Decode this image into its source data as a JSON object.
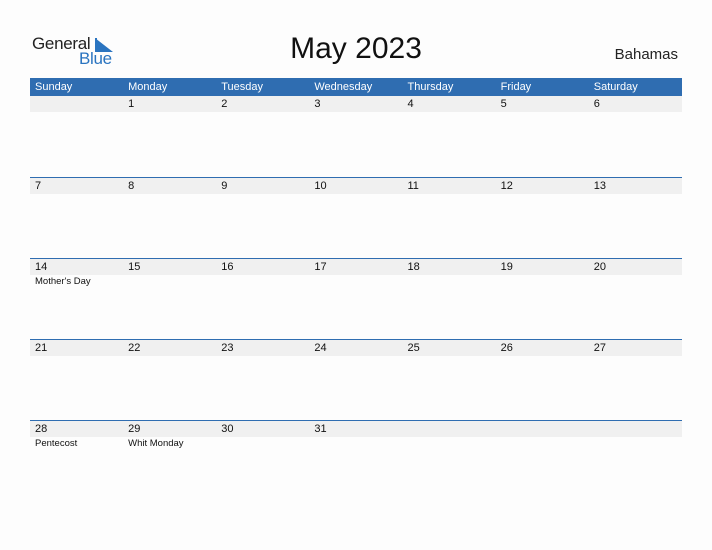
{
  "logo": {
    "word1": "General",
    "word2": "Blue"
  },
  "title": "May 2023",
  "country": "Bahamas",
  "colors": {
    "header_bg": "#2f6db1",
    "accent": "#2a74c0",
    "strip_bg": "#f0f0f0"
  },
  "weekdays": [
    "Sunday",
    "Monday",
    "Tuesday",
    "Wednesday",
    "Thursday",
    "Friday",
    "Saturday"
  ],
  "weeks": [
    {
      "days": [
        "",
        "1",
        "2",
        "3",
        "4",
        "5",
        "6"
      ],
      "events": [
        "",
        "",
        "",
        "",
        "",
        "",
        ""
      ]
    },
    {
      "days": [
        "7",
        "8",
        "9",
        "10",
        "11",
        "12",
        "13"
      ],
      "events": [
        "",
        "",
        "",
        "",
        "",
        "",
        ""
      ]
    },
    {
      "days": [
        "14",
        "15",
        "16",
        "17",
        "18",
        "19",
        "20"
      ],
      "events": [
        "Mother's Day",
        "",
        "",
        "",
        "",
        "",
        ""
      ]
    },
    {
      "days": [
        "21",
        "22",
        "23",
        "24",
        "25",
        "26",
        "27"
      ],
      "events": [
        "",
        "",
        "",
        "",
        "",
        "",
        ""
      ]
    },
    {
      "days": [
        "28",
        "29",
        "30",
        "31",
        "",
        "",
        ""
      ],
      "events": [
        "Pentecost",
        "Whit Monday",
        "",
        "",
        "",
        "",
        ""
      ]
    }
  ]
}
